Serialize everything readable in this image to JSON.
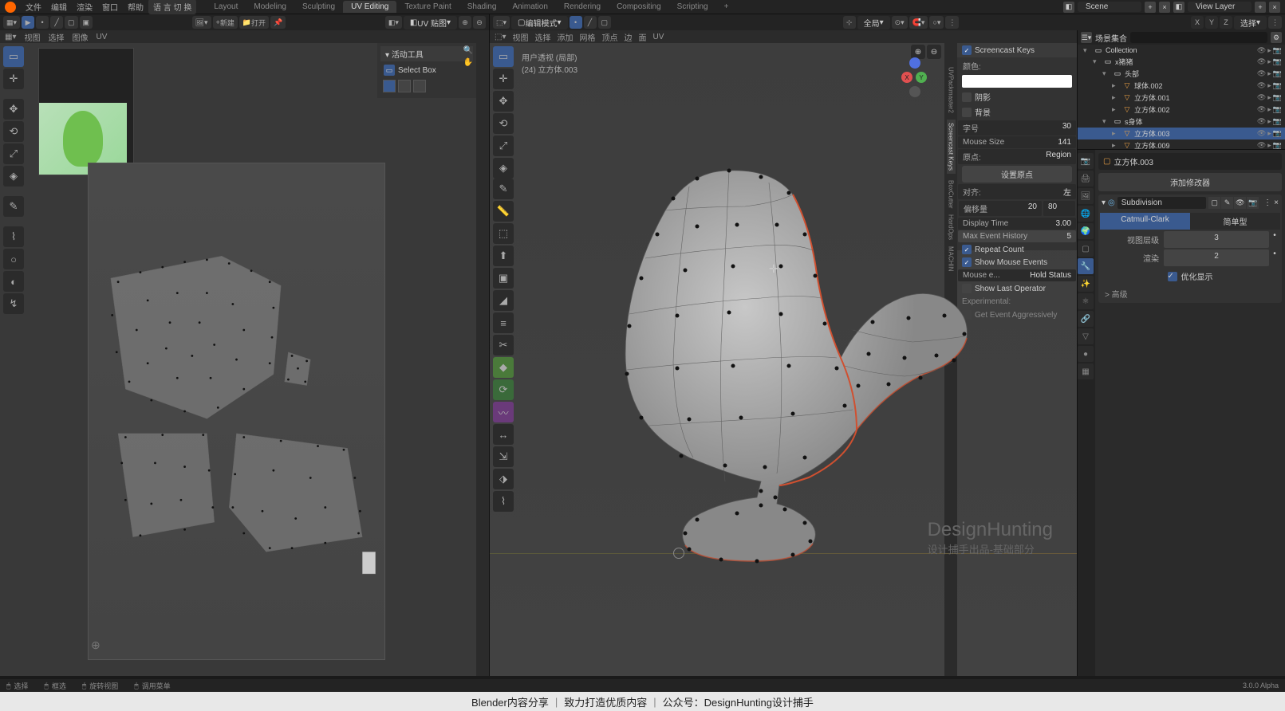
{
  "top_menu": {
    "items": [
      "文件",
      "编辑",
      "渲染",
      "窗口",
      "帮助"
    ],
    "lang_btn": "语 言 切 换",
    "workspaces": [
      "Layout",
      "Modeling",
      "Sculpting",
      "UV Editing",
      "Texture Paint",
      "Shading",
      "Animation",
      "Rendering",
      "Compositing",
      "Scripting"
    ],
    "active_ws": "UV Editing",
    "scene_label": "Scene",
    "layer_label": "View Layer"
  },
  "uv_header": {
    "menus": [
      "视图",
      "选择",
      "图像",
      "UV"
    ],
    "mode_dropdown": "UV 贴图",
    "new_btn": "新建",
    "open_btn": "打开"
  },
  "uv_npanel": {
    "title": "活动工具",
    "tool": "Select Box"
  },
  "vp_header": {
    "mode": "编辑模式",
    "menus": [
      "视图",
      "选择",
      "添加",
      "网格",
      "顶点",
      "边",
      "面",
      "UV"
    ],
    "orientation": "全局",
    "select_dropdown": "选择"
  },
  "vp_info": {
    "line1": "用户透视 (局部)",
    "line2": "(24) 立方体.003"
  },
  "vp_npanel": {
    "title": "Screencast Keys",
    "color_lbl": "颜色:",
    "shadow": "阴影",
    "bg": "背景",
    "font_lbl": "字号",
    "font_val": "30",
    "mouse_lbl": "Mouse Size",
    "mouse_val": "141",
    "origin_lbl": "原点:",
    "origin_val": "Region",
    "setorigin_btn": "设置原点",
    "align_lbl": "对齐:",
    "align_val": "左",
    "offset_lbl": "偏移量",
    "offset_x": "20",
    "offset_y": "80",
    "disptime_lbl": "Display Time",
    "disptime_val": "3.00",
    "maxhist_lbl": "Max Event History",
    "maxhist_val": "5",
    "repeat": "Repeat Count",
    "showmouse": "Show Mouse Events",
    "mousehold_lbl": "Mouse e...",
    "mousehold_val": "Hold Status",
    "showlast": "Show Last Operator",
    "exp_lbl": "Experimental:",
    "getev": "Get Event Aggressively"
  },
  "outliner": {
    "header": "场景集合",
    "items": [
      {
        "indent": 0,
        "tri": "▾",
        "icon": "col",
        "label": "Collection"
      },
      {
        "indent": 1,
        "tri": "▾",
        "icon": "col",
        "label": "x猪猪"
      },
      {
        "indent": 2,
        "tri": "▾",
        "icon": "col",
        "label": "头部"
      },
      {
        "indent": 3,
        "tri": "▸",
        "icon": "obj",
        "label": "球体.002"
      },
      {
        "indent": 3,
        "tri": "▸",
        "icon": "obj",
        "label": "立方体.001"
      },
      {
        "indent": 3,
        "tri": "▸",
        "icon": "obj",
        "label": "立方体.002"
      },
      {
        "indent": 2,
        "tri": "▾",
        "icon": "col",
        "label": "s身体"
      },
      {
        "indent": 3,
        "tri": "▸",
        "icon": "obj",
        "label": "立方体.003",
        "sel": true
      },
      {
        "indent": 3,
        "tri": "▸",
        "icon": "obj",
        "label": "立方体.009"
      }
    ]
  },
  "props": {
    "crumb_obj": "立方体.003",
    "add_mod": "添加修改器",
    "mod_name": "Subdivision",
    "mod_type_a": "Catmull-Clark",
    "mod_type_b": "简单型",
    "level_vp_lbl": "视图层级",
    "level_vp_val": "3",
    "level_rn_lbl": "渲染",
    "level_rn_val": "2",
    "opt_disp": "优化显示",
    "advanced": "> 高级"
  },
  "statusbar": {
    "select": "选择",
    "boxsel": "框选",
    "rot": "旋转视图",
    "menu": "调用菜单",
    "version": "3.0.0 Alpha"
  },
  "watermark": {
    "title": "DesignHunting",
    "sub": "设计捕手出品-基础部分"
  },
  "footer": {
    "p1": "Blender内容分享",
    "p2": "致力打造优质内容",
    "p3": "公众号：DesignHunting设计捕手"
  }
}
